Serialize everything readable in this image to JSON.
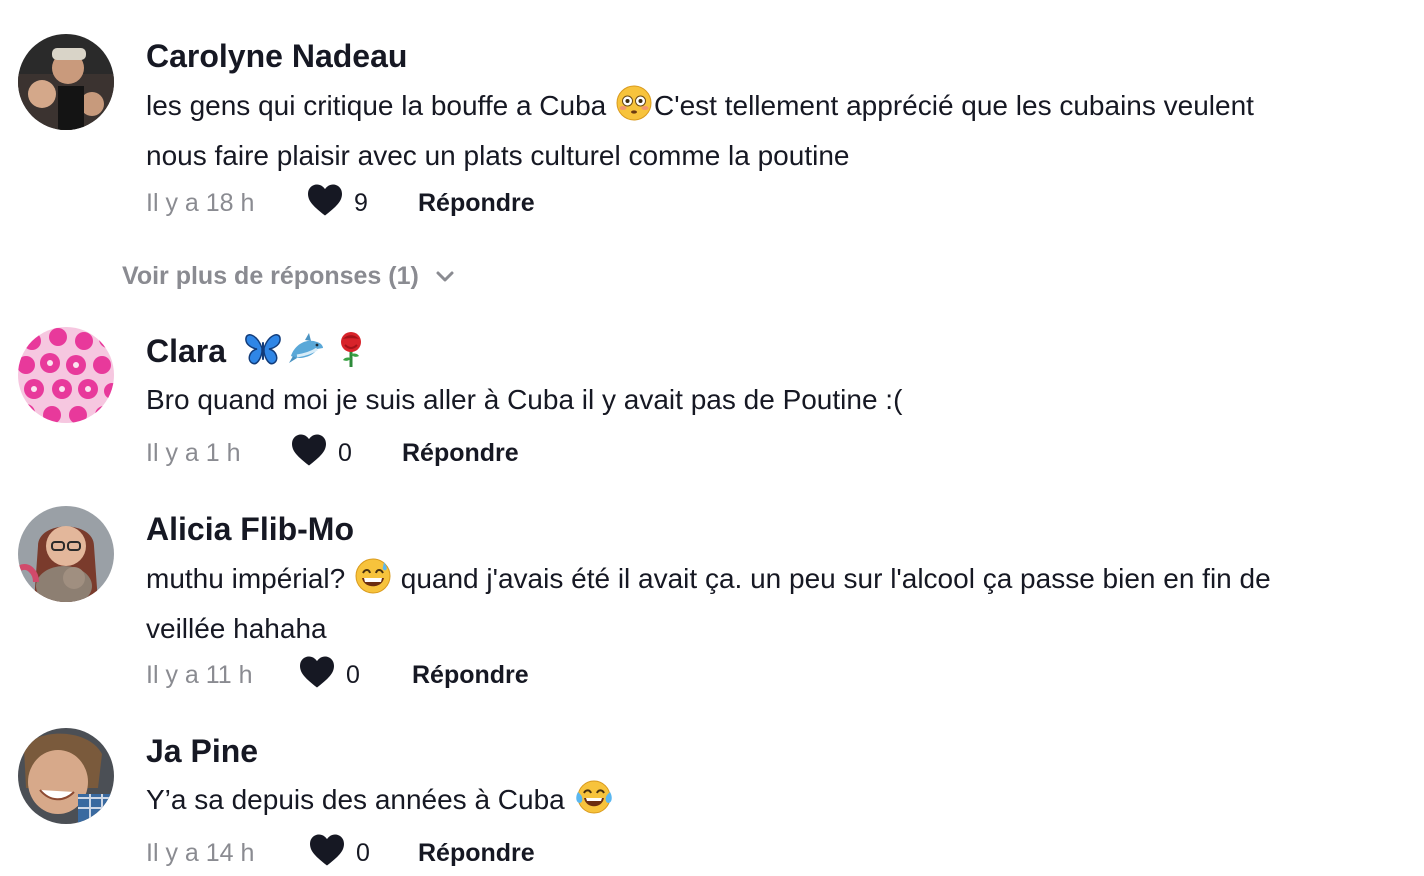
{
  "comments": [
    {
      "author": "Carolyne Nadeau",
      "text_line1_before_emoji": "les gens qui critique la bouffe a Cuba ",
      "emoji1": "flushed-face",
      "text_line1_after_emoji": "C'est tellement apprécié que les cubains veulent",
      "text_line2": "nous faire plaisir avec un plats culturel comme la poutine",
      "time": "Il y a 18 h",
      "likes": "9",
      "reply_label": "Répondre"
    },
    {
      "author": "Clara",
      "author_emojis": [
        "butterfly",
        "dolphin",
        "rose"
      ],
      "text": "Bro quand moi je suis aller à Cuba il y avait pas de Poutine :(",
      "time": "Il y a 1 h",
      "likes": "0",
      "reply_label": "Répondre"
    },
    {
      "author": "Alicia Flib-Mo",
      "text_before_emoji": "muthu impérial? ",
      "emoji1": "grinning-face-with-sweat",
      "text_after_emoji": " quand j'avais été il avait ça. un peu sur l'alcool ça passe bien en fin de",
      "text_line2": "veillée hahaha",
      "time": "Il y a 11 h",
      "likes": "0",
      "reply_label": "Répondre"
    },
    {
      "author": "Ja Pine",
      "text_before_emoji": "Y’a sa depuis des années à Cuba ",
      "emoji1": "face-with-tears-of-joy",
      "time": "Il y a 14 h",
      "likes": "0",
      "reply_label": "Répondre"
    }
  ],
  "more_replies_label": "Voir plus de réponses (1)",
  "colors": {
    "text": "#161823",
    "muted": "#8a8b91",
    "heart": "#161823"
  }
}
